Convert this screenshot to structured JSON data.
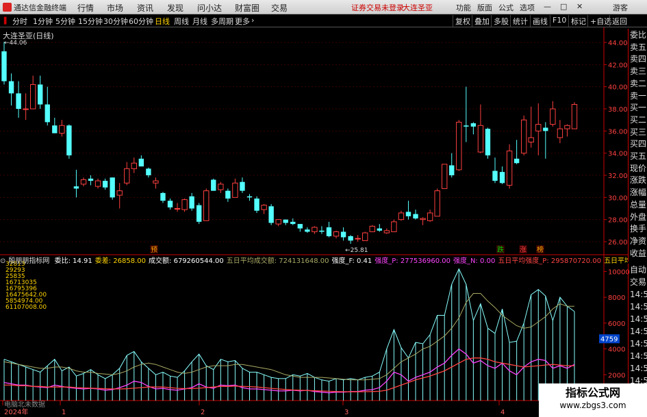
{
  "app": {
    "name": "通达信金融终端",
    "status_text": "证券交易未登录",
    "stock_name": "大连圣亚",
    "user": "游客"
  },
  "menu": [
    "行情",
    "市场",
    "资讯",
    "发现",
    "问小达",
    "财富圈",
    "交易"
  ],
  "right_menu": [
    "功能",
    "版面",
    "公式",
    "选项"
  ],
  "timeframes": [
    "分时",
    "1分钟",
    "5分钟",
    "15分钟",
    "30分钟",
    "60分钟",
    "日线",
    "周线",
    "月线",
    "多周期",
    "更多"
  ],
  "active_timeframe": "日线",
  "tool_buttons": [
    "复权",
    "叠加",
    "多股",
    "统计",
    "画线",
    "F10",
    "标记",
    "+自选",
    "返回"
  ],
  "chart_title": "大连圣亚(日线)",
  "price_high_label": "44.06",
  "price_low_label": "25.81",
  "price_ticks": [
    "44.00",
    "42.00",
    "40.00",
    "38.00",
    "36.00",
    "34.00",
    "32.00",
    "30.00",
    "28.00",
    "26.00"
  ],
  "side_labels": [
    "委比",
    "卖五",
    "卖四",
    "卖三",
    "卖二",
    "卖一",
    "买一",
    "买二",
    "买三",
    "买四",
    "买五",
    "现价",
    "涨跌",
    "涨幅",
    "总量",
    "外盘",
    "换手",
    "净资",
    "收益"
  ],
  "side2_labels": [
    "自动",
    "交易",
    "14:5",
    "14:5",
    "14:5",
    "14:5",
    "14:5",
    "14:5",
    "14:5",
    "14:5"
  ],
  "markers": [
    {
      "text": "预",
      "color": "#ffa500"
    },
    {
      "text": "跌",
      "color": "#00cc00"
    },
    {
      "text": "涨",
      "color": "#ff4040"
    },
    {
      "text": "榜",
      "color": "#ffa500"
    }
  ],
  "indicator": {
    "name": "殷朋朋指标网",
    "items": [
      {
        "label": "委比:",
        "value": "14.91",
        "color": "#ffffff"
      },
      {
        "label": "委差:",
        "value": "26858.00",
        "color": "#ffd400"
      },
      {
        "label": "成交额:",
        "value": "679260544.00",
        "color": "#ffffff"
      },
      {
        "label": "五日平均成交额:",
        "value": "724131648.00",
        "color": "#aaaa66"
      },
      {
        "label": "强度_F:",
        "value": "0.41",
        "color": "#ffffff"
      },
      {
        "label": "强度_P:",
        "value": "277536960.00",
        "color": "#ff44ff"
      },
      {
        "label": "强度_N:",
        "value": "0.00",
        "color": "#ff44ff"
      },
      {
        "label": "五日平均强度_P:",
        "value": "295870720.00",
        "color": "#ff4444"
      },
      {
        "label": "五日平均强度_",
        "value": "",
        "color": "#ffd400"
      }
    ],
    "left_values": [
      "32813",
      "29293",
      "25835",
      "16713035",
      "16795396",
      "16475642.00",
      "5854974.00",
      "61107008.00"
    ],
    "right_ticks": [
      "10000",
      "8000",
      "6000",
      "4000",
      "2000"
    ],
    "tag": "4759"
  },
  "x_axis": [
    "2024年",
    "1",
    "2",
    "3",
    "4"
  ],
  "bottom_label": "电脑北未数据",
  "watermark": {
    "line1": "指标公式网",
    "line2": "www.zbgs3.com"
  },
  "chart_data": {
    "type": "candlestick",
    "ylim": [
      25,
      45
    ],
    "up_color": "#ff4040",
    "down_color": "#54ffff",
    "candles": [
      [
        43.2,
        44.06,
        40.2,
        40.5
      ],
      [
        40.5,
        41.2,
        38.3,
        39.4
      ],
      [
        39.4,
        40.5,
        37.2,
        38.0
      ],
      [
        38.0,
        39.4,
        37.0,
        38.0
      ],
      [
        38.0,
        41.0,
        38.0,
        40.2
      ],
      [
        40.2,
        41.0,
        38.0,
        38.4
      ],
      [
        38.4,
        40.0,
        36.5,
        36.8
      ],
      [
        36.5,
        37.2,
        35.8,
        35.8
      ],
      [
        35.8,
        37.0,
        35.5,
        36.5
      ],
      [
        36.5,
        36.6,
        33.5,
        33.8
      ],
      [
        31.0,
        32.5,
        30.0,
        30.8
      ],
      [
        31.2,
        31.8,
        31.0,
        31.6
      ],
      [
        31.7,
        32.0,
        31.1,
        31.5
      ],
      [
        31.0,
        31.7,
        30.8,
        31.5
      ],
      [
        31.5,
        31.7,
        30.7,
        30.9
      ],
      [
        31.8,
        31.8,
        29.8,
        30.0
      ],
      [
        30.2,
        31.3,
        29.0,
        30.6
      ],
      [
        31.3,
        33.2,
        31.1,
        32.6
      ],
      [
        32.6,
        33.6,
        32.2,
        33.1
      ],
      [
        33.5,
        33.8,
        32.8,
        32.8
      ],
      [
        32.6,
        32.7,
        31.8,
        32.0
      ],
      [
        31.3,
        31.8,
        30.8,
        31.5
      ],
      [
        30.4,
        30.5,
        29.5,
        29.7
      ],
      [
        29.7,
        29.9,
        28.9,
        29.1
      ],
      [
        29.0,
        29.5,
        28.7,
        29.0
      ],
      [
        28.9,
        29.9,
        28.7,
        29.8
      ],
      [
        30.1,
        30.4,
        28.8,
        29.0
      ],
      [
        29.3,
        29.5,
        27.6,
        27.8
      ],
      [
        27.9,
        30.8,
        27.9,
        30.6
      ],
      [
        31.6,
        31.7,
        30.6,
        30.6
      ],
      [
        30.7,
        31.4,
        30.4,
        31.2
      ],
      [
        30.6,
        30.8,
        29.6,
        29.9
      ],
      [
        30.0,
        31.7,
        30.0,
        31.3
      ],
      [
        31.4,
        31.8,
        30.4,
        30.6
      ],
      [
        30.1,
        30.3,
        29.7,
        30.0
      ],
      [
        29.9,
        30.1,
        28.6,
        28.8
      ],
      [
        28.9,
        29.4,
        28.5,
        29.3
      ],
      [
        29.2,
        29.4,
        27.5,
        27.7
      ],
      [
        27.6,
        28.0,
        27.4,
        28.0
      ],
      [
        28.0,
        28.0,
        27.5,
        27.7
      ],
      [
        27.8,
        28.1,
        27.5,
        27.6
      ],
      [
        27.6,
        27.6,
        26.9,
        27.2
      ],
      [
        27.1,
        27.3,
        26.8,
        26.9
      ],
      [
        26.9,
        27.4,
        26.7,
        27.3
      ],
      [
        27.0,
        27.4,
        26.7,
        26.9
      ],
      [
        27.3,
        27.8,
        26.4,
        26.5
      ],
      [
        26.5,
        27.0,
        26.3,
        26.9
      ],
      [
        26.9,
        27.3,
        26.1,
        26.4
      ],
      [
        26.5,
        26.6,
        25.81,
        26.1
      ],
      [
        26.3,
        26.6,
        26.0,
        26.3
      ],
      [
        26.1,
        26.9,
        26.1,
        26.8
      ],
      [
        26.9,
        27.5,
        26.9,
        27.4
      ],
      [
        27.2,
        27.6,
        26.9,
        27.0
      ],
      [
        26.8,
        27.2,
        26.7,
        27.0
      ],
      [
        26.9,
        28.0,
        26.9,
        27.8
      ],
      [
        28.0,
        28.8,
        27.9,
        28.6
      ],
      [
        28.7,
        29.7,
        28.0,
        28.3
      ],
      [
        28.5,
        28.9,
        28.0,
        28.1
      ],
      [
        28.0,
        28.2,
        27.5,
        28.1
      ],
      [
        27.9,
        28.9,
        27.8,
        28.6
      ],
      [
        28.3,
        30.8,
        28.3,
        30.6
      ],
      [
        30.8,
        33.0,
        30.8,
        33.0
      ],
      [
        32.9,
        34.0,
        31.8,
        32.0
      ],
      [
        32.5,
        37.0,
        32.4,
        36.8
      ],
      [
        36.5,
        40.0,
        35.0,
        36.4
      ],
      [
        36.7,
        36.8,
        35.7,
        36.4
      ],
      [
        34.1,
        38.4,
        34.0,
        36.5
      ],
      [
        36.2,
        36.3,
        33.5,
        33.8
      ],
      [
        32.4,
        33.6,
        31.3,
        31.5
      ],
      [
        32.3,
        32.8,
        31.2,
        31.3
      ],
      [
        31.1,
        34.8,
        30.8,
        34.2
      ],
      [
        33.5,
        35.2,
        33.0,
        33.1
      ],
      [
        34.0,
        37.4,
        33.8,
        37.0
      ],
      [
        35.0,
        38.2,
        34.5,
        35.4
      ],
      [
        36.0,
        38.5,
        33.8,
        36.6
      ],
      [
        36.3,
        36.8,
        33.5,
        36.0
      ],
      [
        36.6,
        38.7,
        36.4,
        38.0
      ],
      [
        35.4,
        37.0,
        34.9,
        36.2
      ],
      [
        36.2,
        36.6,
        35.5,
        36.5
      ],
      [
        36.2,
        38.6,
        36.2,
        38.4
      ]
    ],
    "volume": [
      3200,
      3000,
      2800,
      2600,
      2400,
      2200,
      2700,
      3200,
      2300,
      2600,
      1900,
      2100,
      2400,
      2000,
      1700,
      2000,
      2500,
      3500,
      3800,
      3000,
      2500,
      2000,
      2200,
      1900,
      1800,
      2300,
      3000,
      3600,
      2700,
      2400,
      3200,
      3000,
      3100,
      2500,
      2200,
      2200,
      2000,
      1800,
      1700,
      1700,
      2000,
      1900,
      2100,
      1800,
      1600,
      1500,
      1700,
      1600,
      1700,
      1600,
      1800,
      1900,
      2200,
      4000,
      5500,
      4100,
      3300,
      4500,
      4400,
      5100,
      6600,
      6600,
      9000,
      10200,
      9000,
      6200,
      7500,
      5600,
      5200,
      7100,
      4500,
      4600,
      6000,
      8200,
      8600,
      8100,
      6200,
      8000,
      7300,
      6900
    ],
    "pos_strength": [
      1400,
      1300,
      1200,
      1200,
      1100,
      1050,
      1000,
      1200,
      1100,
      1000,
      950,
      900,
      950,
      900,
      800,
      850,
      1000,
      1200,
      1500,
      1400,
      1100,
      900,
      950,
      850,
      800,
      900,
      1000,
      1300,
      1050,
      950,
      1200,
      1150,
      1200,
      1000,
      900,
      900,
      850,
      800,
      750,
      750,
      800,
      750,
      800,
      700,
      650,
      600,
      650,
      650,
      700,
      700,
      800,
      850,
      1000,
      1500,
      2200,
      2000,
      1500,
      1800,
      2000,
      2200,
      2600,
      2900,
      3500,
      4000,
      3600,
      2900,
      3100,
      2700,
      2500,
      2900,
      2300,
      2000,
      2600,
      3000,
      3200,
      3100,
      2500,
      2700,
      2500,
      2800
    ],
    "avg_amount": [
      3000,
      2900,
      2800,
      2700,
      2600,
      2500,
      2500,
      2600,
      2600,
      2500,
      2300,
      2200,
      2200,
      2100,
      2050,
      2000,
      2100,
      2300,
      2600,
      2800,
      2900,
      2800,
      2600,
      2400,
      2200,
      2100,
      2200,
      2400,
      2600,
      2700,
      2700,
      2700,
      2800,
      2800,
      2700,
      2600,
      2500,
      2400,
      2200,
      2000,
      1900,
      1800,
      1800,
      1800,
      1800,
      1750,
      1700,
      1650,
      1600,
      1600,
      1600,
      1650,
      1700,
      2000,
      2500,
      3000,
      3300,
      3600,
      4000,
      4200,
      4600,
      5000,
      5600,
      6400,
      7600,
      8300,
      8300,
      7700,
      7200,
      6600,
      6200,
      5800,
      5600,
      5700,
      6100,
      6500,
      7100,
      7500,
      7300,
      7300
    ],
    "avg_strength": [
      1200,
      1200,
      1150,
      1150,
      1100,
      1100,
      1050,
      1050,
      1050,
      1050,
      1000,
      980,
      960,
      940,
      920,
      900,
      900,
      920,
      960,
      1000,
      1050,
      1050,
      1050,
      1000,
      950,
      930,
      930,
      960,
      1000,
      1050,
      1100,
      1100,
      1120,
      1100,
      1080,
      1050,
      1000,
      950,
      900,
      860,
      820,
      800,
      780,
      760,
      740,
      720,
      700,
      690,
      680,
      680,
      690,
      700,
      720,
      800,
      1000,
      1200,
      1400,
      1600,
      1750,
      1900,
      2100,
      2300,
      2600,
      2900,
      3200,
      3300,
      3300,
      3200,
      3000,
      2900,
      2800,
      2700,
      2600,
      2650,
      2700,
      2750,
      2800,
      2750,
      2700,
      2700
    ]
  }
}
